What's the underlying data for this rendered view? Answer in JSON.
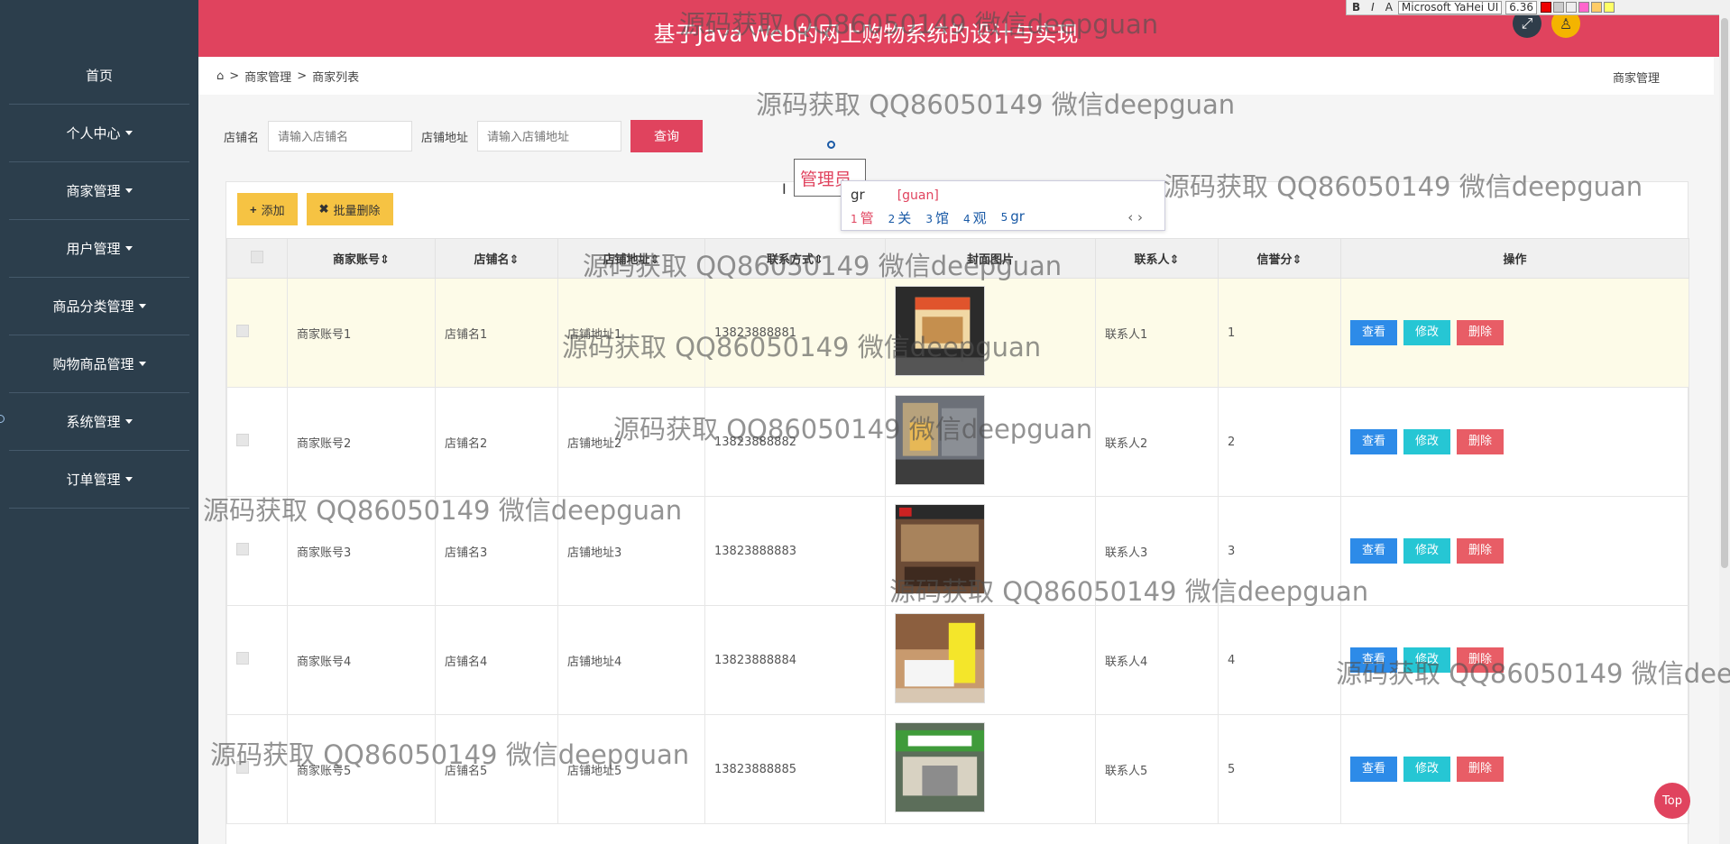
{
  "sidebar": {
    "items": [
      {
        "label": "首页",
        "has_caret": false
      },
      {
        "label": "个人中心",
        "has_caret": true
      },
      {
        "label": "商家管理",
        "has_caret": true
      },
      {
        "label": "用户管理",
        "has_caret": true
      },
      {
        "label": "商品分类管理",
        "has_caret": true
      },
      {
        "label": "购物商品管理",
        "has_caret": true
      },
      {
        "label": "系统管理",
        "has_caret": true
      },
      {
        "label": "订单管理",
        "has_caret": true
      }
    ]
  },
  "header": {
    "title": "基于Java Web的网上购物系统的设计与实现",
    "color": "#e0435e"
  },
  "format_toolbar": {
    "bold": "B",
    "italic": "I",
    "font": "Microsoft YaHei UI",
    "size": "6.36"
  },
  "breadcrumb": {
    "items": [
      "商家管理",
      "商家列表"
    ],
    "right_label": "商家管理"
  },
  "search": {
    "shop_name_label": "店铺名",
    "shop_name_placeholder": "请输入店铺名",
    "address_label": "店铺地址",
    "address_placeholder": "请输入店铺地址",
    "query_label": "查询"
  },
  "ime": {
    "composing": "管理员",
    "input": "gr",
    "pinyin": "[guan]",
    "candidates": [
      {
        "n": "1",
        "c": "管"
      },
      {
        "n": "2",
        "c": "关"
      },
      {
        "n": "3",
        "c": "馆"
      },
      {
        "n": "4",
        "c": "观"
      },
      {
        "n": "5",
        "c": "gr"
      }
    ],
    "nav": "‹ ›"
  },
  "toolbar": {
    "add_label": "添加",
    "batch_delete_label": "批量删除"
  },
  "table": {
    "headers": [
      "商家账号",
      "店铺名",
      "店铺地址",
      "联系方式",
      "封面图片",
      "联系人",
      "信誉分",
      "操作"
    ],
    "actions": {
      "view": "查看",
      "edit": "修改",
      "delete": "删除"
    },
    "rows": [
      {
        "account": "商家账号1",
        "shop": "店铺名1",
        "address": "店铺地址1",
        "phone": "13823888881",
        "contact": "联系人1",
        "score": "1"
      },
      {
        "account": "商家账号2",
        "shop": "店铺名2",
        "address": "店铺地址2",
        "phone": "13823888882",
        "contact": "联系人2",
        "score": "2"
      },
      {
        "account": "商家账号3",
        "shop": "店铺名3",
        "address": "店铺地址3",
        "phone": "13823888883",
        "contact": "联系人3",
        "score": "3"
      },
      {
        "account": "商家账号4",
        "shop": "店铺名4",
        "address": "店铺地址4",
        "phone": "13823888884",
        "contact": "联系人4",
        "score": "4"
      },
      {
        "account": "商家账号5",
        "shop": "店铺名5",
        "address": "店铺地址5",
        "phone": "13823888885",
        "contact": "联系人5",
        "score": "5"
      }
    ]
  },
  "top_button": "Top",
  "watermark": "源码获取 QQ86050149 微信deepguan"
}
